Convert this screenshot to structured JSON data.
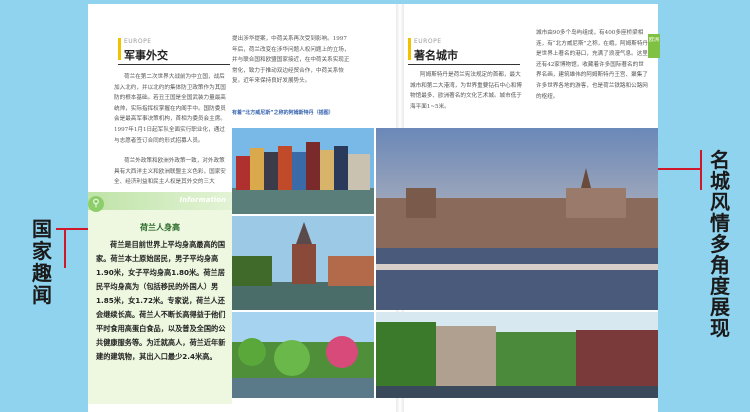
{
  "left_page": {
    "section1": {
      "en_label": "EUROPE",
      "title": "军事外交"
    },
    "para1": "荷兰在第二次世界大战前为中立国，战后加入北约，并以北约的集体防卫政策作为其国防的根本基础。若丑王国是全国武装力量最高统帅，实际指挥权掌握在内阁手中。国防委员会是最高军事决策机构，首相为委员会主席。1997年1月1日起军队全面实行职业化，通过与志愿者签订合同的形式招募人员。",
    "para2": "荷兰外政策和欧洲外政策一致，对外政策具有大西洋主义和欧洲联盟主义色彩，国家安全、经济利益和民主人权是其外交的三大",
    "para3": "提出涉华提案，中荷关系再次受到影响。1997年后，荷兰改变在涉华问题人权问题上的立场，并与联合国和欧盟国家接近，在中荷关系实现正常化，致力于推动双边经贸合作，中荷关系恢复。近年来保持良好发展势头。",
    "photo_caption": "有着“北方威尼斯”之称的阿姆斯特丹（插图）",
    "info_tag": "Information",
    "info_title": "荷兰人身高",
    "info_body": "荷兰是目前世界上平均身高最高的国家。荷兰本土原始居民，男子平均身高1.90米，女子平均身高1.80米。荷兰居民平均身高为（包括移民的外国人）男1.85米，女1.72米。专家说，荷兰人还会继续长高。荷兰人不断长高得益于他们平时食用高蛋白食品，以及普及全国的公共健康服务等。为迁就高人，荷兰近年新建的建筑物，其出入口最少2.4米高。"
  },
  "right_page": {
    "section2": {
      "en_label": "EUROPE",
      "title": "著名城市"
    },
    "para1": "阿姆斯特丹是荷兰宪法规定的首都，最大城市和第二大港湾，为世界重要钻石中心和博物馆最多、欧洲著名的文化艺术城。城市低于海平面1~5米。",
    "para2": "城市由90多个岛屿组成，有400多座桥梁相连，有“北方威尼斯”之称，在峨，阿姆斯特丹是世界上著名的港口，充满了浪漫气息。这里还有42家博物馆，收藏着许多国际著名的世界名画，建筑雄伟的阿姆斯特丹王宫、聚集了许多世界各地的游客，也是荷兰铁路和公路网的枢纽。",
    "tab_label": "欧洲"
  },
  "side_labels": {
    "left": "国家趣闻",
    "right": "名城风情多角度展现"
  }
}
